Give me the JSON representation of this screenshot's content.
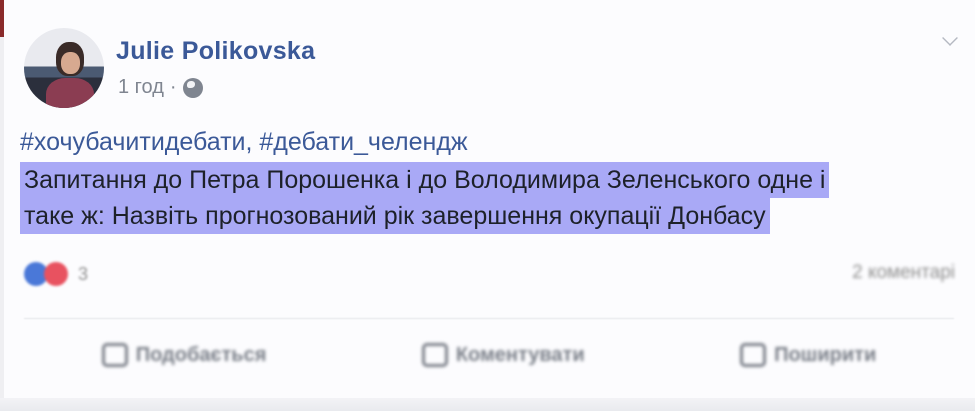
{
  "post": {
    "author": "Julie Polikovska",
    "time": "1 год",
    "separator": "·",
    "hashtags": "#хочубачитидебати, #дебати_челендж",
    "text_line1": "Запитання до Петра Порошенка і до Володимира Зеленського одне і",
    "text_line2": "таке ж: Назвіть прогнозований рік завершення окупації Донбасу",
    "reactions_count": "3",
    "comments": "2 коментарі"
  },
  "actions": {
    "like": "Подобається",
    "comment": "Коментувати",
    "share": "Поширити"
  },
  "icons": {
    "audience": "globe-icon",
    "menu": "chevron-down-icon",
    "like": "thumbs-up-icon",
    "comment": "comment-icon",
    "share": "share-icon"
  },
  "colors": {
    "author": "#3b5998",
    "highlight": "#a9a9f6",
    "like_reaction": "#4a78d8",
    "love_reaction": "#e85260"
  }
}
